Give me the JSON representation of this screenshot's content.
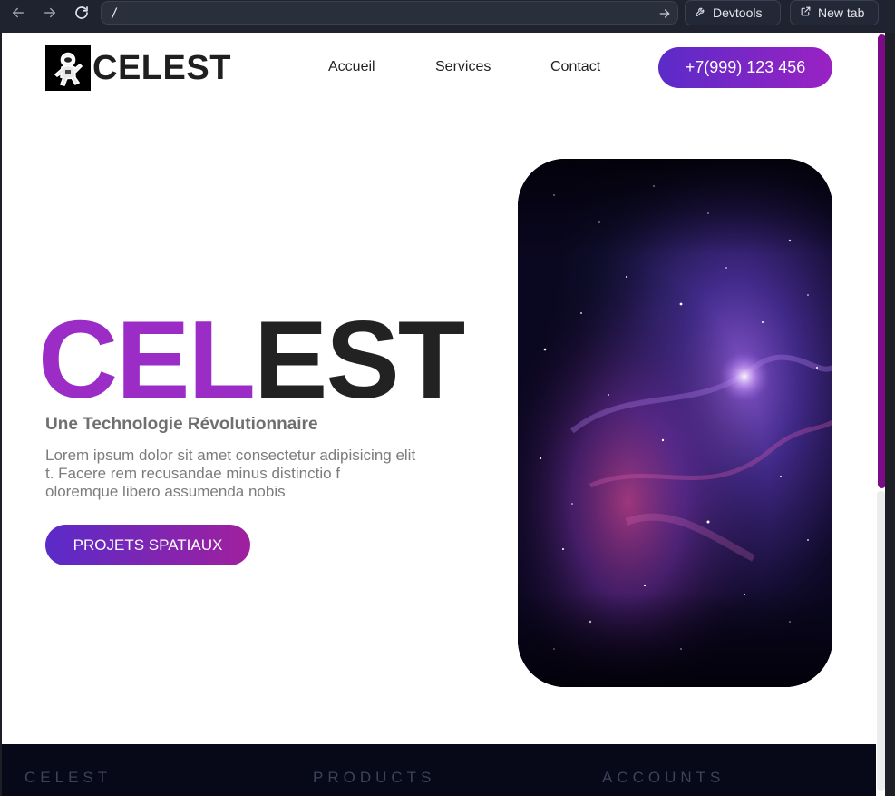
{
  "browser": {
    "address": "/",
    "devtools_label": "Devtools",
    "new_tab_label": "New tab"
  },
  "header": {
    "logo_text": "CELEST",
    "nav": [
      "Accueil",
      "Services",
      "Contact"
    ],
    "phone": "+7(999) 123 456"
  },
  "hero": {
    "title_accent": "CEL",
    "title_rest": "EST",
    "tagline": "Une Technologie Révolutionnaire",
    "body_lines": [
      "Lorem ipsum dolor sit amet consectetur adipisicing elit",
      "t. Facere rem recusandae minus distinctio f",
      "oloremque libero assumenda nobis"
    ],
    "cta": "PROJETS SPATIAUX"
  },
  "footer": {
    "columns": [
      "CELEST",
      "PRODUCTS",
      "ACCOUNTS"
    ]
  },
  "colors": {
    "accent": "#9b2cc6",
    "gradient_start": "#5b2bc8",
    "gradient_end": "#9a22c3",
    "footer_bg": "#070818",
    "scroll_thumb": "#7b0b86"
  }
}
